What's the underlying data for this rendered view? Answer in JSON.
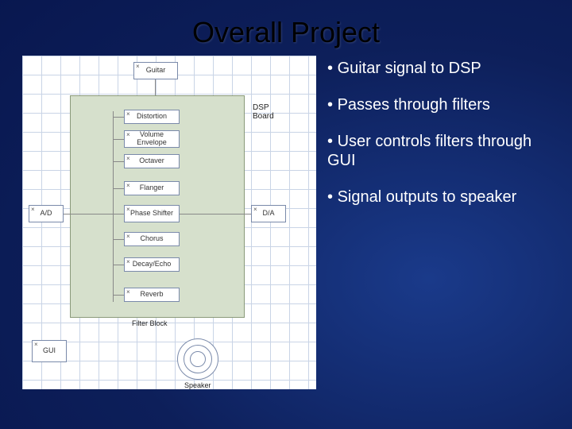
{
  "title": "Overall Project",
  "bullets": [
    "Guitar signal to DSP",
    "Passes through filters",
    "User controls filters through GUI",
    "Signal outputs to speaker"
  ],
  "diagram": {
    "guitar": "Guitar",
    "gui": "GUI",
    "ad": "A/D",
    "da": "D/A",
    "dsp_label": "DSP\nBoard",
    "filters": [
      "Distortion",
      "Volume Envelope",
      "Octaver",
      "Flanger",
      "Phase Shifter",
      "Chorus",
      "Decay/Echo",
      "Reverb"
    ],
    "filter_block_label": "Filter Block",
    "speaker_label": "Speaker"
  }
}
